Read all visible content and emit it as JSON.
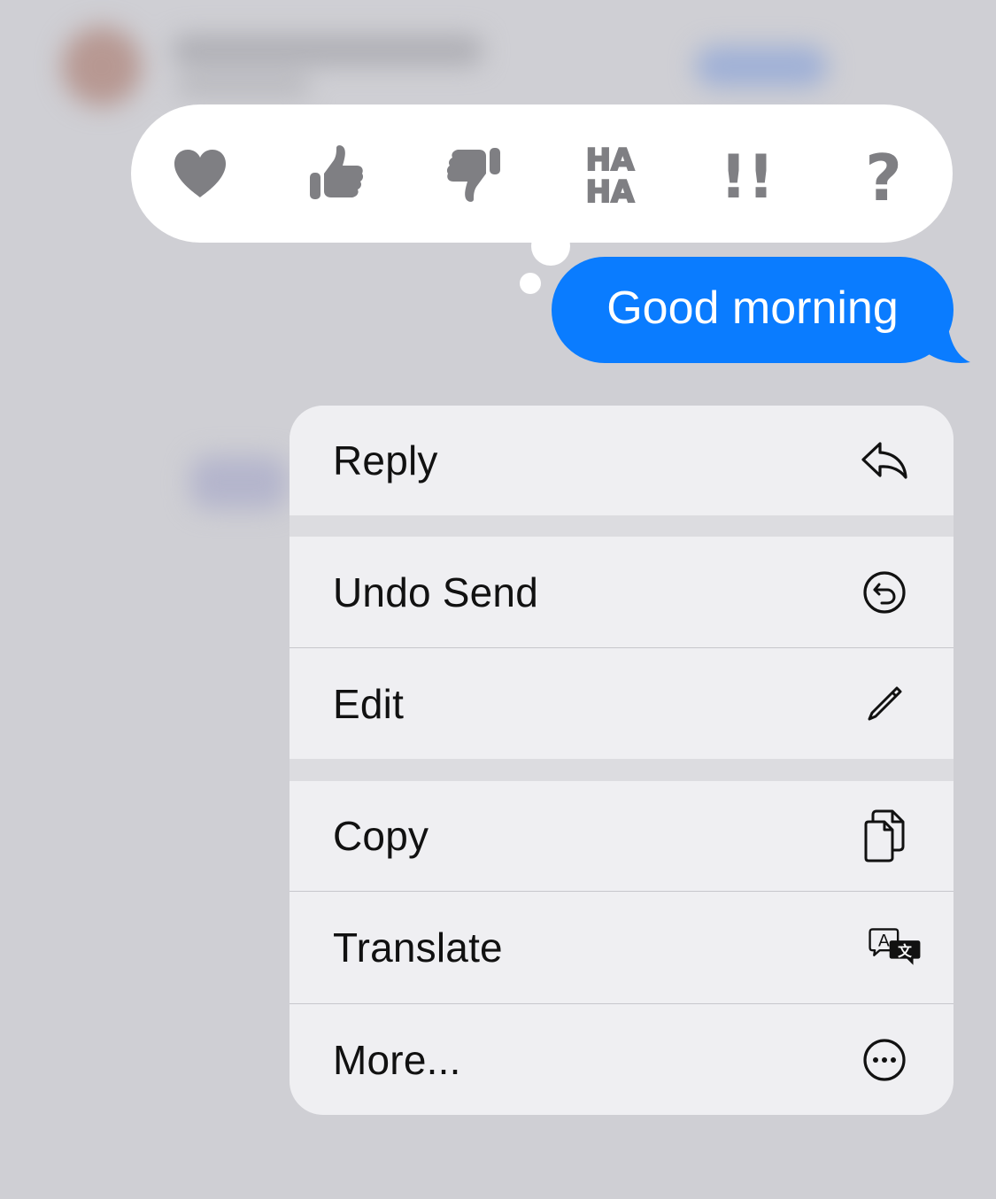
{
  "message": {
    "text": "Good morning",
    "bubble_color": "#0a7cff"
  },
  "reactions": [
    {
      "name": "heart",
      "icon": "heart-icon"
    },
    {
      "name": "thumbs-up",
      "icon": "thumbs-up-icon"
    },
    {
      "name": "thumbs-down",
      "icon": "thumbs-down-icon"
    },
    {
      "name": "haha",
      "icon": "haha-icon",
      "text_top": "HA",
      "text_bottom": "HA"
    },
    {
      "name": "emphasize",
      "icon": "double-exclamation-icon",
      "text": "!!"
    },
    {
      "name": "question",
      "icon": "question-mark-icon",
      "text": "?"
    }
  ],
  "reaction_icon_color": "#7f7f83",
  "menu": {
    "reply": {
      "label": "Reply",
      "icon": "reply-arrow-icon"
    },
    "undo_send": {
      "label": "Undo Send",
      "icon": "undo-circle-icon"
    },
    "edit": {
      "label": "Edit",
      "icon": "pencil-icon"
    },
    "copy": {
      "label": "Copy",
      "icon": "copy-documents-icon"
    },
    "translate": {
      "label": "Translate",
      "icon": "translate-icon",
      "glyph_latin": "A",
      "glyph_other": "文"
    },
    "more": {
      "label": "More...",
      "icon": "ellipsis-circle-icon"
    }
  }
}
